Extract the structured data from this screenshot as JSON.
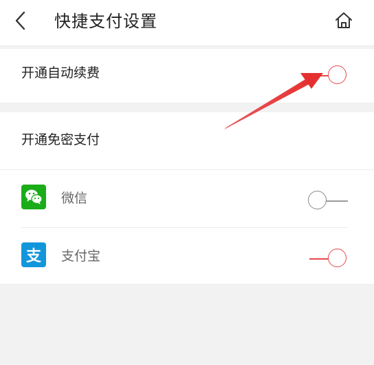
{
  "header": {
    "title": "快捷支付设置",
    "back_icon": "chevron-left-icon",
    "home_icon": "home-icon"
  },
  "auto_renew": {
    "label": "开通自动续费",
    "enabled": true
  },
  "password_free": {
    "section_label": "开通免密支付",
    "methods": [
      {
        "label": "微信",
        "icon": "wechat-icon",
        "enabled": false,
        "brand_color": "#1aad19"
      },
      {
        "label": "支付宝",
        "icon": "alipay-icon",
        "enabled": true,
        "brand_color": "#1296db"
      }
    ]
  },
  "colors": {
    "accent": "#e5484d",
    "background": "#f2f2f2"
  }
}
